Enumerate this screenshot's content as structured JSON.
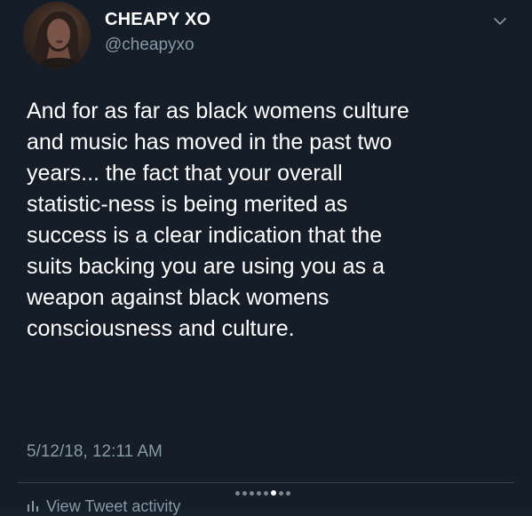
{
  "tweet": {
    "display_name": "CHEAPY XO",
    "handle": "@cheapyxo",
    "text": "And for as far as black womens culture\nand music has moved in the past two\nyears... the fact that your overall\nstatistic-ness is being merited as\nsuccess is a clear indication that the\nsuits backing you are using you as a\nweapon against black womens\nconsciousness and culture.",
    "timestamp": "5/12/18, 12:11 AM",
    "activity_label": "View Tweet activity"
  },
  "icons": {
    "menu": "chevron-down-icon",
    "activity": "bar-chart-icon"
  },
  "carousel": {
    "total": 8,
    "active_index": 5
  },
  "colors": {
    "background": "#141d28",
    "text_primary": "#ffffff",
    "text_secondary": "#8899a6",
    "divider": "#38444d"
  }
}
